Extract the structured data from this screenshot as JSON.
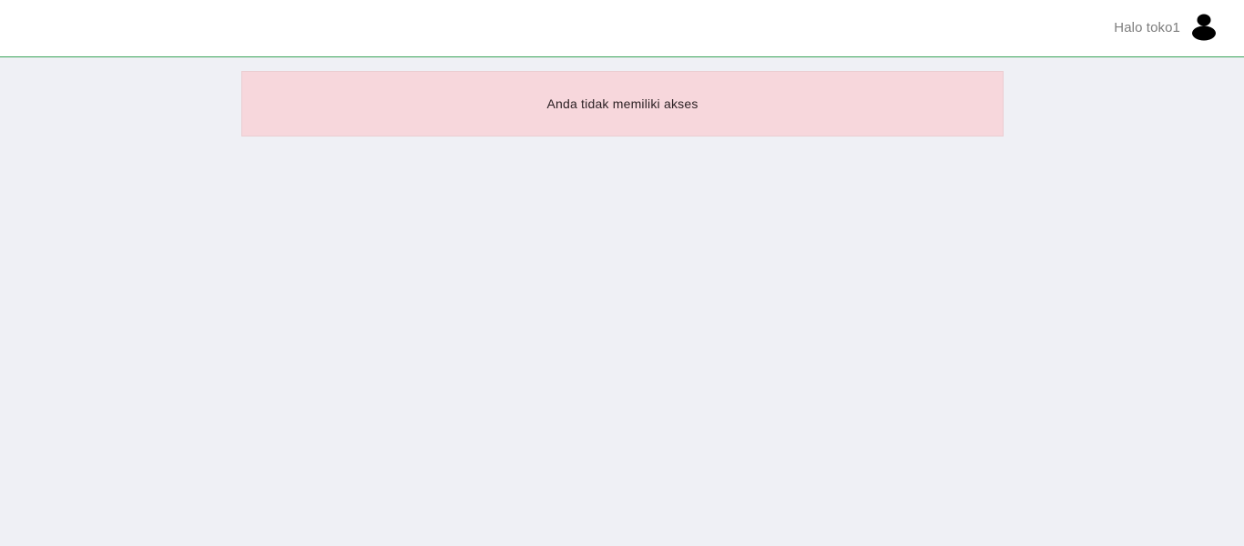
{
  "header": {
    "greeting": "Halo toko1",
    "avatar_icon": "user-icon",
    "border_color": "#3aa35a"
  },
  "alert": {
    "message": "Anda tidak memiliki akses",
    "background_color": "#f7d7dc"
  }
}
